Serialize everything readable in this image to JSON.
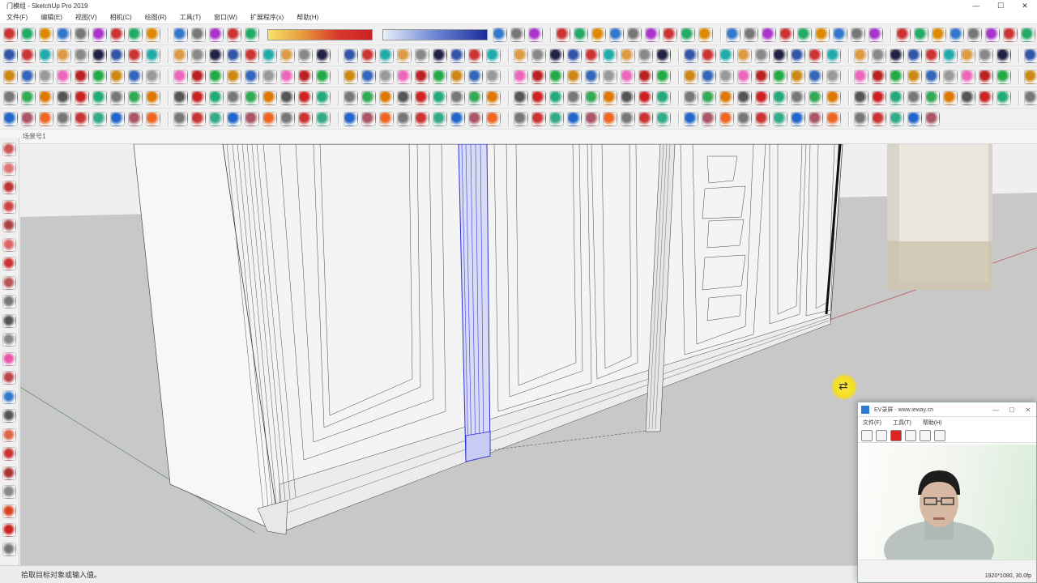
{
  "window": {
    "title": "门模组 - SketchUp Pro 2019",
    "minimize": "—",
    "maximize": "☐",
    "close": "✕"
  },
  "menu": [
    "文件(F)",
    "编辑(E)",
    "视图(V)",
    "相机(C)",
    "绘图(R)",
    "工具(T)",
    "窗口(W)",
    "扩展程序(x)",
    "帮助(H)"
  ],
  "status_hint": "场景号1",
  "status_bar": "拾取目标对象或输入值。",
  "colors": {
    "selection": "#2b2fd6",
    "cursor_highlight": "#f3dd25"
  },
  "toolbar_rows": [
    {
      "count": 60,
      "accent": [
        "#c33",
        "#2a6",
        "#d80",
        "#37c",
        "#777",
        "#a3c"
      ]
    },
    {
      "count": 62,
      "accent": [
        "#224",
        "#35a",
        "#c33",
        "#2aa",
        "#d94",
        "#888"
      ]
    },
    {
      "count": 68,
      "accent": [
        "#b22",
        "#2a4",
        "#c81",
        "#36b",
        "#999",
        "#e6b"
      ]
    },
    {
      "count": 70,
      "accent": [
        "#555",
        "#c22",
        "#2a7",
        "#777",
        "#3a5",
        "#d70"
      ]
    },
    {
      "count": 50,
      "accent": [
        "#e62",
        "#777",
        "#c33",
        "#3a8",
        "#26c",
        "#a56"
      ]
    }
  ],
  "left_toolbar_count": 22,
  "recorder": {
    "title": "EV录屏 - www.ieway.cn",
    "menu": [
      "文件(F)",
      "工具(T)",
      "帮助(H)"
    ],
    "resolution": "1920*1080, 30.0fp"
  }
}
